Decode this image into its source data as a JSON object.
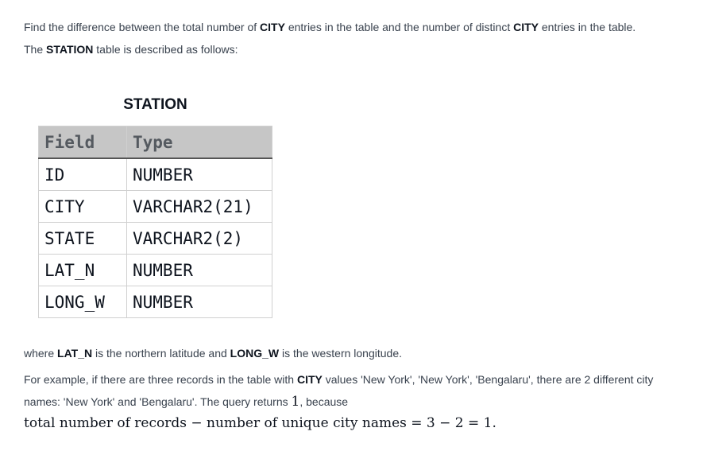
{
  "intro": {
    "line1": {
      "a": "Find the difference between the total number of ",
      "b": "CITY",
      "c": " entries in the table and the number of distinct ",
      "d": "CITY",
      "e": " entries in the table."
    },
    "line2": {
      "a": "The ",
      "b": "STATION",
      "c": " table is described as follows:"
    }
  },
  "table": {
    "caption": "STATION",
    "headers": [
      "Field",
      "Type"
    ],
    "rows": [
      [
        "ID",
        "NUMBER"
      ],
      [
        "CITY",
        "VARCHAR2(21)"
      ],
      [
        "STATE",
        "VARCHAR2(2)"
      ],
      [
        "LAT_N",
        "NUMBER"
      ],
      [
        "LONG_W",
        "NUMBER"
      ]
    ]
  },
  "where_line": {
    "a": "where ",
    "b": "LAT_N",
    "c": " is the northern latitude and ",
    "d": "LONG_W",
    "e": " is the western longitude."
  },
  "example": {
    "a": "For example, if there are three records in the table with ",
    "b": "CITY",
    "c": " values 'New York', 'New York', 'Bengalaru', there are 2 different city names: 'New York' and 'Bengalaru'. The query returns ",
    "d": "1",
    "e": ", because"
  },
  "formula": "total number of records − number of unique city names = 3 − 2 = 1."
}
